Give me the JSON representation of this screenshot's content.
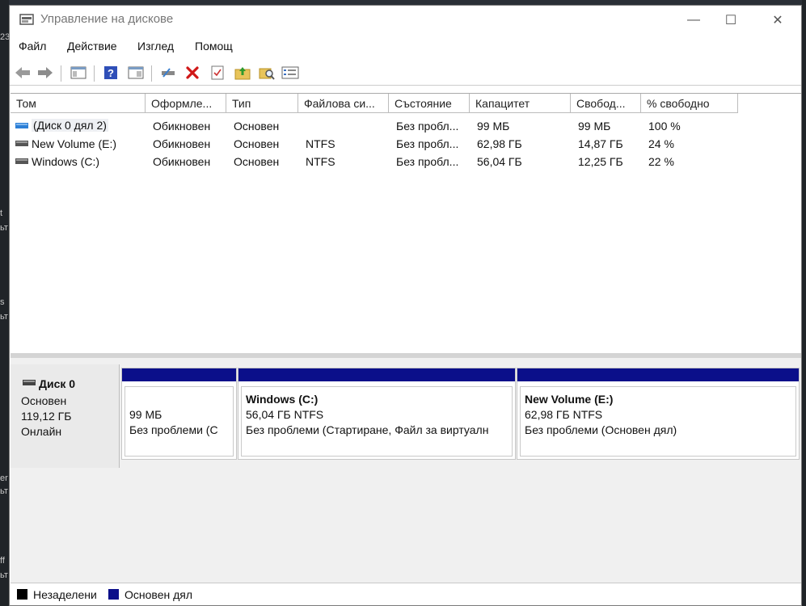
{
  "window": {
    "title": "Управление на дискове",
    "minimize": "—",
    "maximize": "☐",
    "close": "✕"
  },
  "menu": [
    "Файл",
    "Действие",
    "Изглед",
    "Помощ"
  ],
  "toolbar": [
    "back-arrow-icon",
    "forward-arrow-icon",
    "console-tree-icon",
    "help-icon",
    "properties-icon",
    "connect-disk-icon",
    "delete-icon",
    "check-icon",
    "folder-up-icon",
    "folder-search-icon",
    "settings-list-icon"
  ],
  "columns": [
    "Том",
    "Оформле...",
    "Тип",
    "Файлова си...",
    "Състояние",
    "Капацитет",
    "Свобод...",
    "% свободно"
  ],
  "volumes": [
    {
      "name": "(Диск 0 дял 2)",
      "layout": "Обикновен",
      "type": "Основен",
      "fs": "",
      "status": "Без пробл...",
      "capacity": "99 МБ",
      "free": "99 МБ",
      "pct": "100 %"
    },
    {
      "name": "New Volume (E:)",
      "layout": "Обикновен",
      "type": "Основен",
      "fs": "NTFS",
      "status": "Без пробл...",
      "capacity": "62,98 ГБ",
      "free": "14,87 ГБ",
      "pct": "24 %"
    },
    {
      "name": "Windows (C:)",
      "layout": "Обикновен",
      "type": "Основен",
      "fs": "NTFS",
      "status": "Без пробл...",
      "capacity": "56,04 ГБ",
      "free": "12,25 ГБ",
      "pct": "22 %"
    }
  ],
  "disk": {
    "name": "Диск 0",
    "type": "Основен",
    "size": "119,12 ГБ",
    "state": "Онлайн"
  },
  "partitions": [
    {
      "title": "",
      "size": "99 МБ",
      "status": "Без проблеми (С"
    },
    {
      "title": "Windows  (C:)",
      "size": "56,04 ГБ NTFS",
      "status": "Без проблеми (Стартиране, Файл за виртуалн"
    },
    {
      "title": "New Volume  (E:)",
      "size": "62,98 ГБ NTFS",
      "status": "Без проблеми (Основен дял)"
    }
  ],
  "legend": [
    {
      "label": "Незаделени",
      "color": "#000000"
    },
    {
      "label": "Основен дял",
      "color": "#0b0f8a"
    }
  ],
  "desktop_left_text": [
    "23",
    "t",
    "ьт",
    "s",
    "ьт",
    "er",
    "ьт",
    "ff",
    "ьт"
  ]
}
